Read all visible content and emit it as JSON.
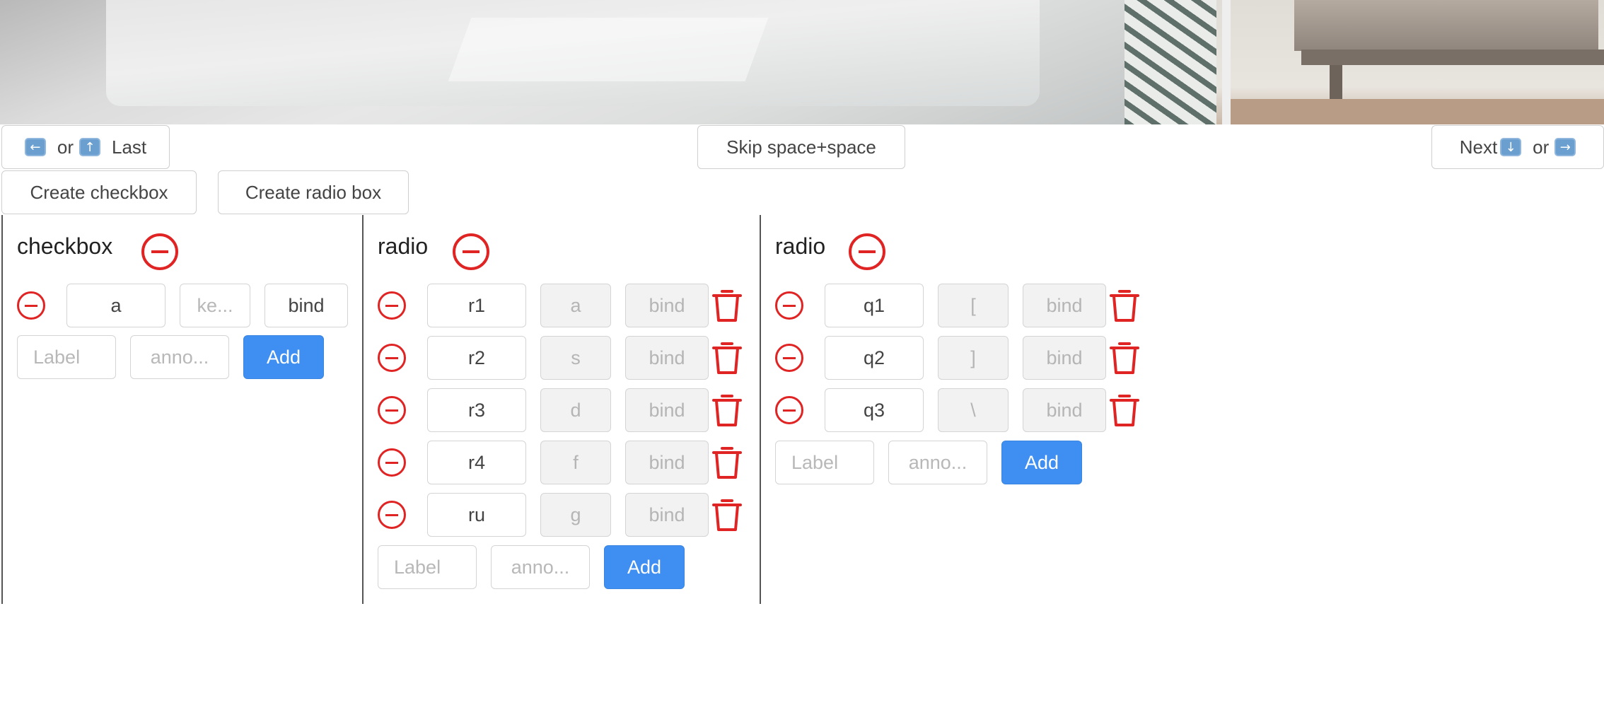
{
  "nav": {
    "prev": {
      "or": "or",
      "label": "Last"
    },
    "skip_label": "Skip space+space",
    "next": {
      "label": "Next",
      "or": "or"
    }
  },
  "create": {
    "checkbox_label": "Create checkbox",
    "radio_label": "Create radio box"
  },
  "panels": [
    {
      "title": "checkbox",
      "items": [
        {
          "label": "a",
          "key": "ke...",
          "bind": "bind"
        }
      ],
      "new_item": {
        "label_placeholder": "Label",
        "anno_placeholder": "anno...",
        "add_label": "Add"
      }
    },
    {
      "title": "radio",
      "items": [
        {
          "label": "r1",
          "key": "a",
          "bind": "bind"
        },
        {
          "label": "r2",
          "key": "s",
          "bind": "bind"
        },
        {
          "label": "r3",
          "key": "d",
          "bind": "bind"
        },
        {
          "label": "r4",
          "key": "f",
          "bind": "bind"
        },
        {
          "label": "ru",
          "key": "g",
          "bind": "bind"
        }
      ],
      "new_item": {
        "label_placeholder": "Label",
        "anno_placeholder": "anno...",
        "add_label": "Add"
      }
    },
    {
      "title": "radio",
      "items": [
        {
          "label": "q1",
          "key": "[",
          "bind": "bind"
        },
        {
          "label": "q2",
          "key": "]",
          "bind": "bind"
        },
        {
          "label": "q3",
          "key": "\\",
          "bind": "bind"
        }
      ],
      "new_item": {
        "label_placeholder": "Label",
        "anno_placeholder": "anno...",
        "add_label": "Add"
      }
    }
  ],
  "colors": {
    "accent": "#3f8ff2",
    "danger": "#e02424",
    "border": "#d4d4d4"
  }
}
